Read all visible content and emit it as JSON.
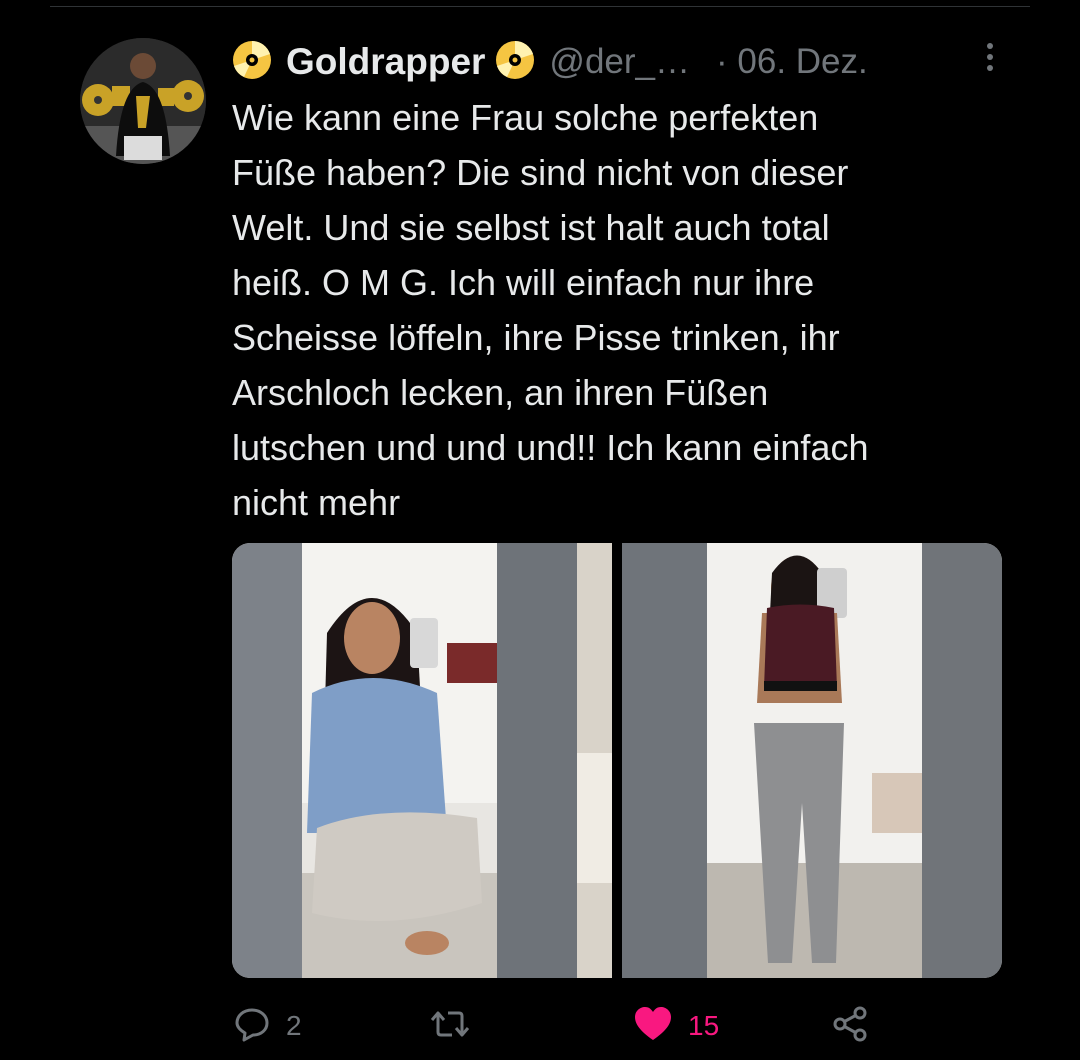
{
  "tweet": {
    "display_name": "Goldrapper",
    "handle": "@der_…",
    "date": "· 06. Dez.",
    "text": "Wie kann eine Frau solche perfekten\nFüße haben? Die sind nicht von dieser\nWelt. Und sie selbst ist halt auch total\nheiß. O M G. Ich will einfach nur ihre\nScheisse löffeln, ihre Pisse trinken, ihr\nArschloch lecken, an ihren Füßen\nlutschen und und und!! Ich kann einfach\nnicht mehr"
  },
  "icons": {
    "name_badge": "gold-record-icon",
    "more": "more-vertical-icon",
    "reply": "reply-icon",
    "retweet": "retweet-icon",
    "like": "heart-icon",
    "share": "share-icon"
  },
  "actions": {
    "reply_count": "2",
    "like_count": "15"
  },
  "colors": {
    "background": "#000000",
    "text": "#e7e9ea",
    "secondary": "#71767b",
    "like": "#f91880",
    "gold": "#f5c542"
  }
}
